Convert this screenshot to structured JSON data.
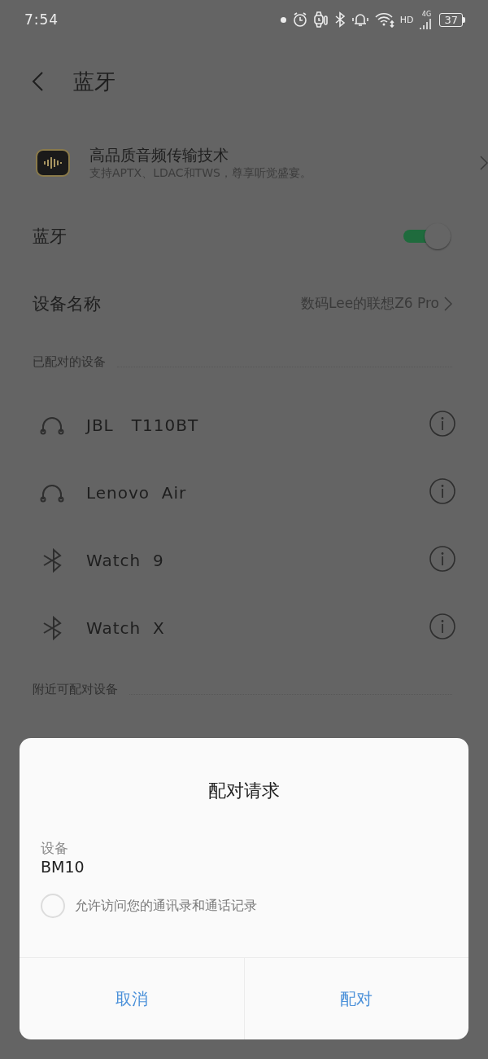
{
  "status_bar": {
    "time": "7:54",
    "network": "HD",
    "signal_type": "4G",
    "battery": "37"
  },
  "header": {
    "title": "蓝牙"
  },
  "audio_feature": {
    "title": "高品质音频传输技术",
    "subtitle": "支持APTX、LDAC和TWS，尊享听觉盛宴。"
  },
  "bluetooth": {
    "label": "蓝牙",
    "on": true
  },
  "device_name": {
    "label": "设备名称",
    "value": "数码Lee的联想Z6 Pro"
  },
  "paired_section": {
    "title": "已配对的设备"
  },
  "paired_devices": [
    {
      "name": "JBL   T110BT",
      "kind": "headphones"
    },
    {
      "name": "Lenovo  Air",
      "kind": "headphones"
    },
    {
      "name": "Watch  9",
      "kind": "bluetooth"
    },
    {
      "name": "Watch  X",
      "kind": "bluetooth"
    }
  ],
  "nearby_section": {
    "title": "附近可配对设备"
  },
  "dialog": {
    "title": "配对请求",
    "device_label": "设备",
    "device_name": "BM10",
    "permission": {
      "label": "允许访问您的通讯录和通话记录",
      "checked": false
    },
    "buttons": [
      "取消",
      "配对"
    ]
  }
}
